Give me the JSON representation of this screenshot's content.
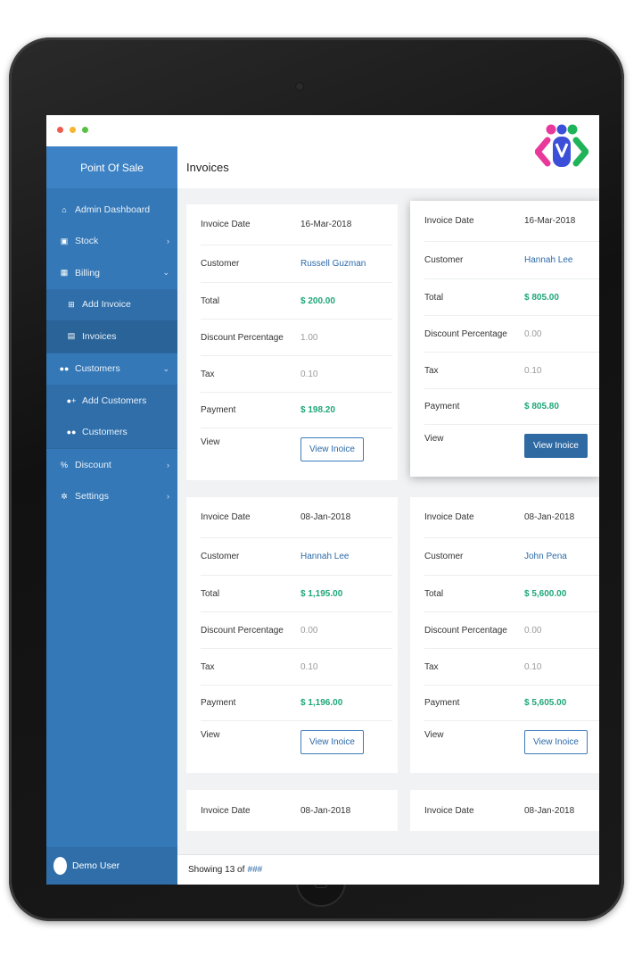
{
  "window": {
    "controls": [
      "close",
      "minimize",
      "maximize"
    ]
  },
  "sidebar": {
    "brand": "Point Of Sale",
    "items": [
      {
        "label": "Admin Dashboard",
        "icon": "home-icon"
      },
      {
        "label": "Stock",
        "icon": "cubes-icon",
        "chevron": "›"
      },
      {
        "label": "Billing",
        "icon": "calculator-icon",
        "chevron": "⌄"
      },
      {
        "label": "Add Invoice",
        "icon": "plus-square-icon"
      },
      {
        "label": "Invoices",
        "icon": "file-icon"
      },
      {
        "label": "Customers",
        "icon": "users-icon",
        "chevron": "⌄"
      },
      {
        "label": "Add Customers",
        "icon": "user-plus-icon"
      },
      {
        "label": "Customers",
        "icon": "users-icon"
      },
      {
        "label": "Discount",
        "icon": "percent-icon",
        "chevron": "›"
      },
      {
        "label": "Settings",
        "icon": "gear-icon",
        "chevron": "›"
      }
    ],
    "user": "Demo User"
  },
  "header": {
    "title": "Invoices"
  },
  "labels": {
    "date": "Invoice Date",
    "customer": "Customer",
    "total": "Total",
    "discount": "Discount Percentage",
    "tax": "Tax",
    "payment": "Payment",
    "view": "View",
    "button": "View Inoice"
  },
  "invoices": [
    {
      "date": "16-Mar-2018",
      "customer": "Russell Guzman",
      "total": "$ 200.00",
      "discount": "1.00",
      "tax": "0.10",
      "payment": "$ 198.20"
    },
    {
      "date": "16-Mar-2018",
      "customer": "Hannah Lee",
      "total": "$ 805.00",
      "discount": "0.00",
      "tax": "0.10",
      "payment": "$ 805.80"
    },
    {
      "date": "08-Jan-2018",
      "customer": "Hannah Lee",
      "total": "$ 1,195.00",
      "discount": "0.00",
      "tax": "0.10",
      "payment": "$ 1,196.00"
    },
    {
      "date": "08-Jan-2018",
      "customer": "John Pena",
      "total": "$ 5,600.00",
      "discount": "0.00",
      "tax": "0.10",
      "payment": "$ 5,605.00"
    },
    {
      "date": "08-Jan-2018"
    },
    {
      "date": "08-Jan-2018"
    }
  ],
  "footer": {
    "showing": "Showing 13 of",
    "count": "###"
  },
  "colors": {
    "sidebar": "#3478b7",
    "accent": "#2d6aa8",
    "money": "#1fa67a"
  }
}
